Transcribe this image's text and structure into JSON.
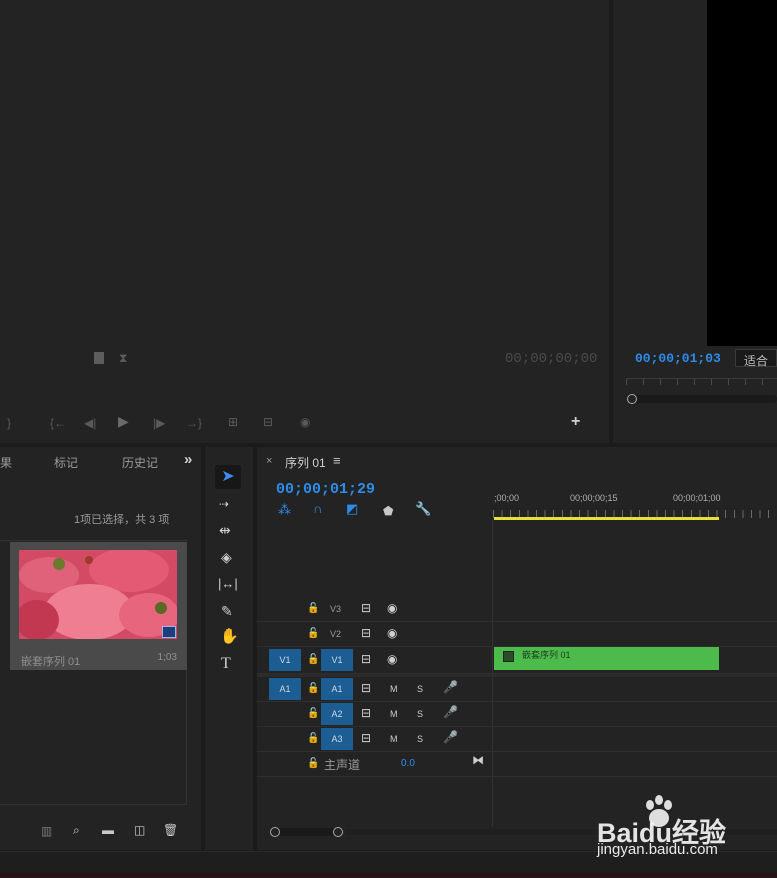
{
  "source_monitor": {
    "timecode": "00;00;00;00"
  },
  "program_monitor": {
    "timecode": "00;00;01;03",
    "fit_label": "适合"
  },
  "project_panel": {
    "tabs": [
      "果",
      "标记",
      "历史记"
    ],
    "more": "»",
    "selection_status": "1项已选择，共 3 项",
    "item": {
      "name": "嵌套序列 01",
      "duration": "1;03"
    }
  },
  "timeline": {
    "tab_label": "序列 01",
    "close": "×",
    "menu": "≡",
    "timecode": "00;00;01;29",
    "ruler_ticks": [
      ";00;00",
      "00;00;00;15",
      "00;00;01;00"
    ],
    "video_tracks": [
      {
        "name": "V3",
        "source": ""
      },
      {
        "name": "V2",
        "source": ""
      },
      {
        "name": "V1",
        "source": "V1"
      }
    ],
    "audio_tracks": [
      {
        "name": "A1",
        "source": "A1",
        "m": "M",
        "s": "S"
      },
      {
        "name": "A2",
        "source": "",
        "m": "M",
        "s": "S"
      },
      {
        "name": "A3",
        "source": "",
        "m": "M",
        "s": "S"
      }
    ],
    "master": {
      "label": "主声道",
      "value": "0.0"
    },
    "clip": {
      "label": "嵌套序列 01",
      "color": "#4cbb4c"
    }
  },
  "watermark": {
    "brand": "Baidu经验",
    "url": "jingyan.baidu.com"
  },
  "colors": {
    "accent": "#2d8ceb",
    "clip_green": "#4cbb4c",
    "work_area": "#e8e03a",
    "track_selected": "#1c5d93"
  }
}
